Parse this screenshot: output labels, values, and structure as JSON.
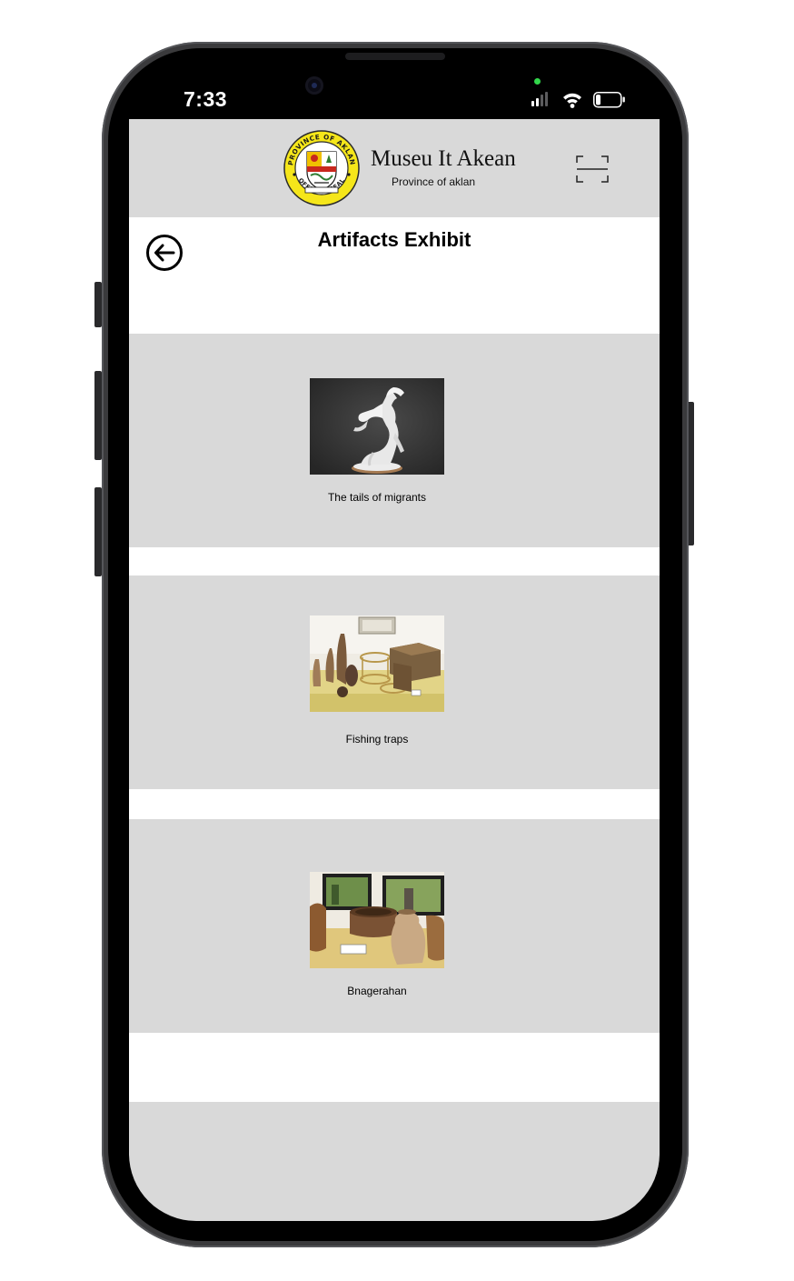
{
  "status_bar": {
    "time": "7:33"
  },
  "header": {
    "brand_title": "Museu It Akean",
    "brand_subtitle": "Province of aklan",
    "seal": {
      "top_text": "PROVINCE OF AKLAN",
      "bottom_text": "OFFICIAL SEAL"
    }
  },
  "page": {
    "title": "Artifacts Exhibit"
  },
  "artifacts": [
    {
      "caption": "The tails of migrants",
      "image_icon": "horse-statue-image"
    },
    {
      "caption": "Fishing traps",
      "image_icon": "fishing-traps-image"
    },
    {
      "caption": "Bnagerahan",
      "image_icon": "pottery-image"
    }
  ],
  "colors": {
    "screen_bg": "#d9d9d9",
    "section_bg": "#ffffff",
    "text": "#000000",
    "seal_yellow": "#f5e61a"
  }
}
